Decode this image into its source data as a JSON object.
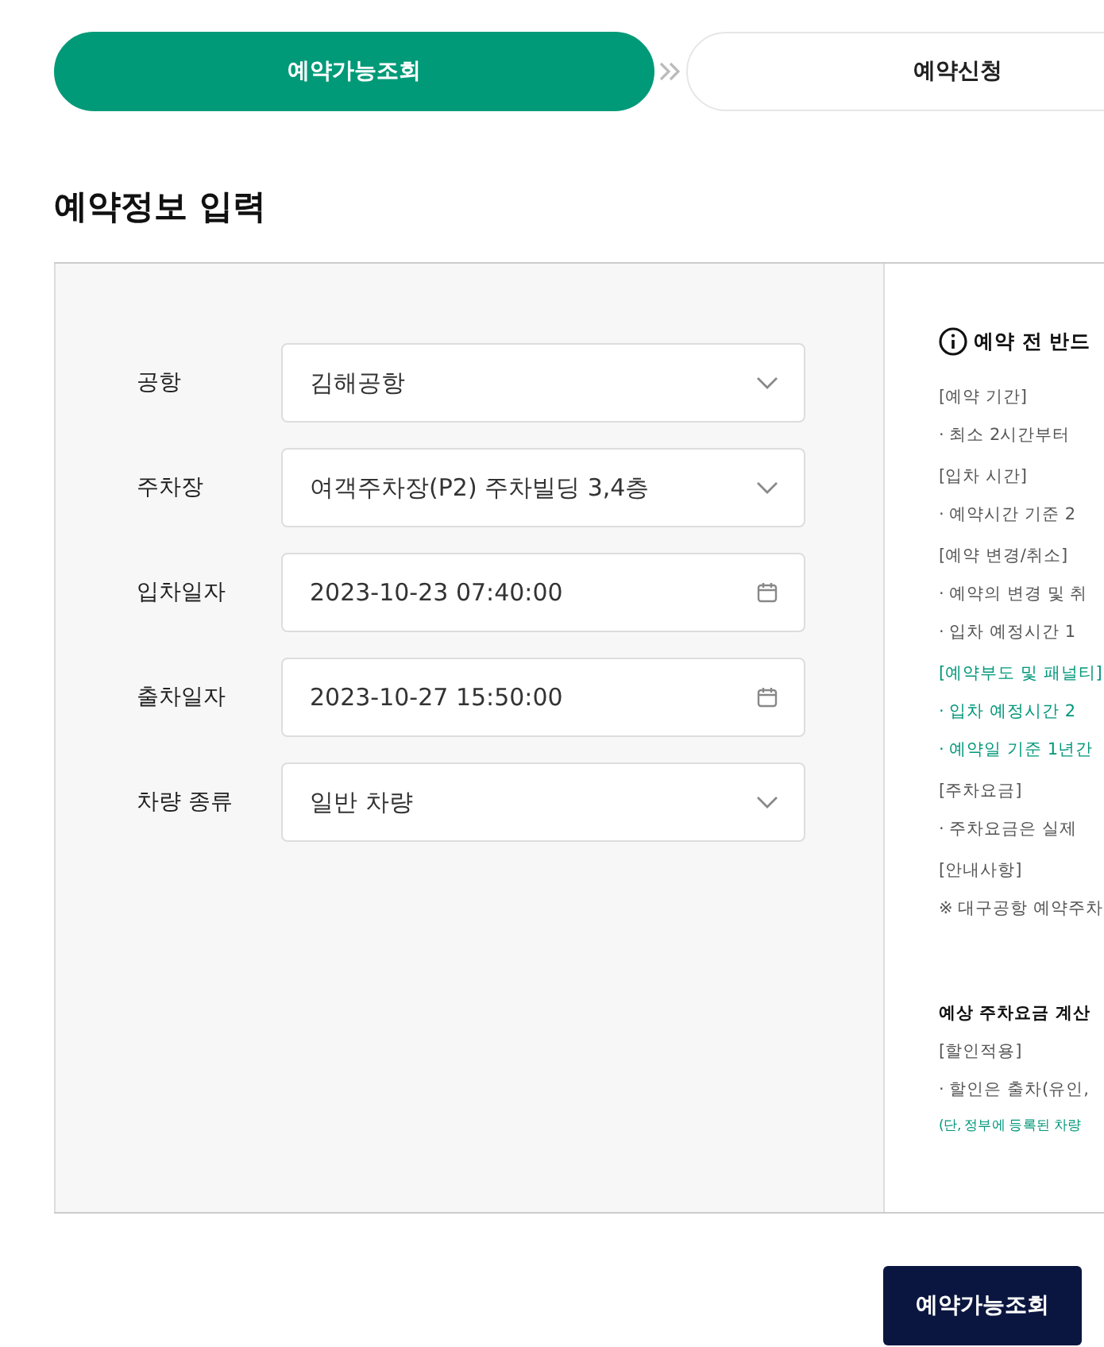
{
  "steps": [
    {
      "label": "예약가능조회",
      "selected": true
    },
    {
      "label": "예약신청",
      "selected": false
    }
  ],
  "title": "예약정보 입력",
  "form": [
    {
      "label": "공항",
      "kind": "select",
      "value": "김해공항"
    },
    {
      "label": "주차장",
      "kind": "select",
      "value": "여객주차장(P2) 주차빌딩 3,4층"
    },
    {
      "label": "입차일자",
      "kind": "date",
      "value": "2023-10-23 07:40:00"
    },
    {
      "label": "출차일자",
      "kind": "date",
      "value": "2023-10-27 15:50:00"
    },
    {
      "label": "차량 종류",
      "kind": "select",
      "value": "일반 차량"
    }
  ],
  "notice": {
    "heading": "예약 전 반드",
    "sections": [
      {
        "title": "[예약 기간]",
        "highlight": false,
        "lines": [
          "· 최소 2시간부터"
        ]
      },
      {
        "title": "[입차 시간]",
        "highlight": false,
        "lines": [
          "· 예약시간 기준 2"
        ]
      },
      {
        "title": "[예약 변경/취소]",
        "highlight": false,
        "lines": [
          "· 예약의 변경 및 취",
          "· 입차 예정시간 1"
        ]
      },
      {
        "title": "[예약부도 및 패널티]",
        "highlight": true,
        "lines": [
          "· 입차 예정시간 2",
          "· 예약일 기준 1년간"
        ]
      },
      {
        "title": "[주차요금]",
        "highlight": false,
        "lines": [
          "· 주차요금은 실제"
        ]
      },
      {
        "title": "[안내사항]",
        "highlight": false,
        "lines": [
          "※ 대구공항 예약주차"
        ]
      }
    ],
    "fee_heading": "예상 주차요금 계산",
    "fee_sections": [
      {
        "title": "[할인적용]",
        "highlight": false,
        "lines": [
          "· 할인은 출차(유인,"
        ]
      }
    ],
    "footnote": "(단, 정부에 등록된 차량"
  },
  "submit": "예약가능조회"
}
